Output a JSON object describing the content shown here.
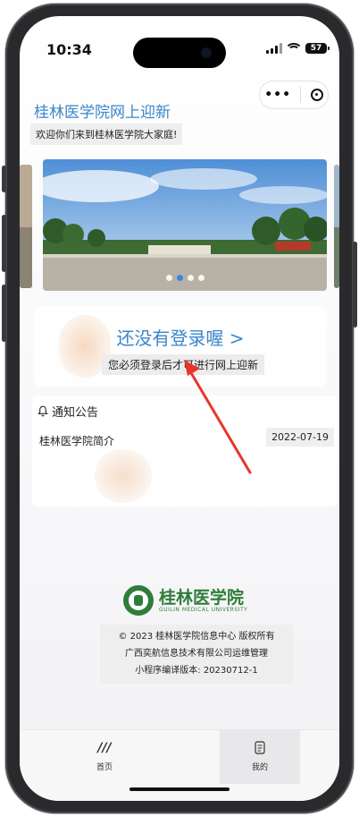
{
  "status": {
    "time": "10:34",
    "battery": "57"
  },
  "capsule": {
    "more_label": "•••"
  },
  "header": {
    "title": "桂林医学院网上迎新",
    "welcome": "欢迎你们来到桂林医学院大家庭!"
  },
  "banner": {
    "active_index": 1,
    "count": 4
  },
  "login": {
    "title": "还没有登录喔 >",
    "subtitle": "您必须登录后才可进行网上迎新"
  },
  "notice": {
    "header": "通知公告",
    "items": [
      {
        "title": "桂林医学院简介",
        "date": "2022-07-19"
      }
    ]
  },
  "footer": {
    "logo_cn": "桂林医学院",
    "logo_en": "GUILIN MEDICAL UNIVERSITY",
    "copyright": "© 2023 桂林医学院信息中心 版权所有",
    "operator": "广西奕航信息技术有限公司运维管理",
    "version": "小程序编译版本: 20230712-1"
  },
  "tabbar": {
    "tabs": [
      {
        "label": "首页"
      },
      {
        "label": "我的"
      }
    ]
  },
  "colors": {
    "accent": "#3a86c8",
    "logo_green": "#2e7d3a",
    "arrow": "#e8352b"
  }
}
